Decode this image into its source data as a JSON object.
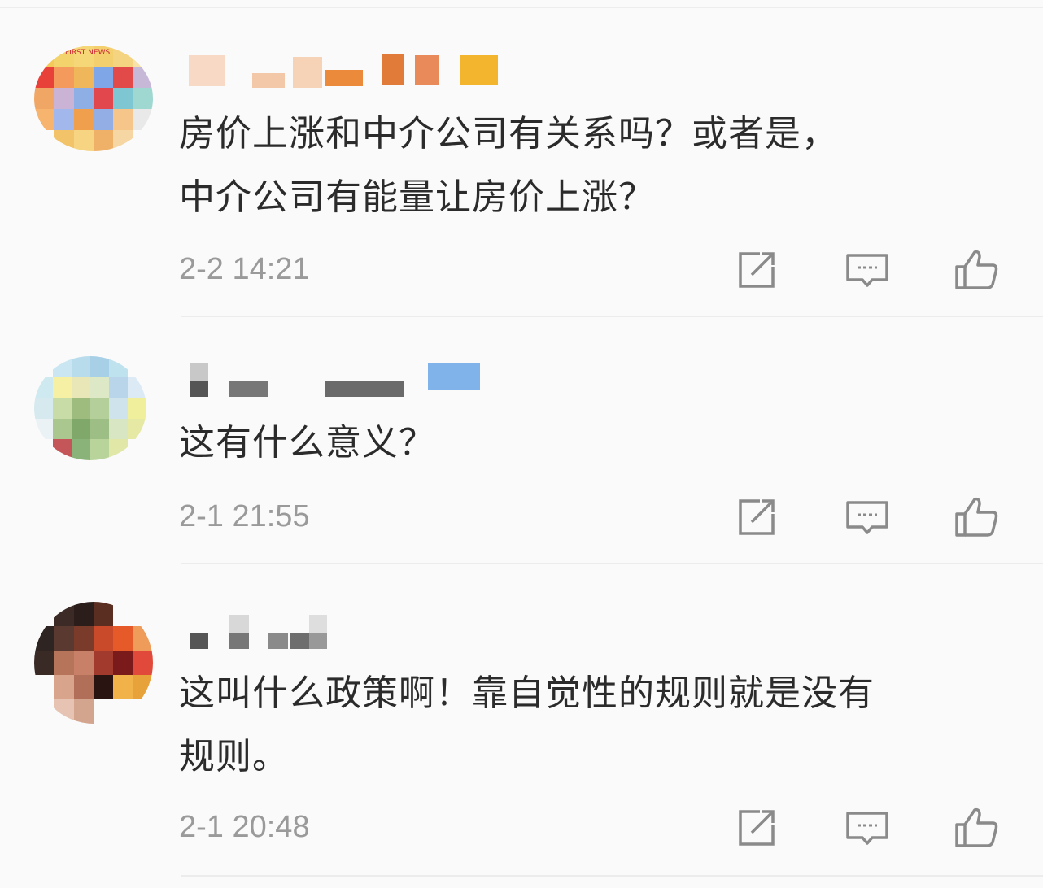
{
  "comments": [
    {
      "text_line1": "房价上涨和中介公司有关系吗？或者是，",
      "text_line2": "中介公司有能量让房价上涨？",
      "time": "2-2 14:21",
      "avatar_badge": "FIRST NEWS"
    },
    {
      "text_line1": "这有什么意义？",
      "time": "2-1 21:55"
    },
    {
      "text_line1": "这叫什么政策啊！靠自觉性的规则就是没有",
      "text_line2": "规则。",
      "time": "2-1 20:48"
    }
  ],
  "icons": {
    "share": "share-icon",
    "comment": "comment-icon",
    "like": "thumbs-up-icon"
  },
  "colors": {
    "text": "#2b2b2b",
    "meta": "#9a9a9a",
    "icon": "#8a8a8a"
  }
}
